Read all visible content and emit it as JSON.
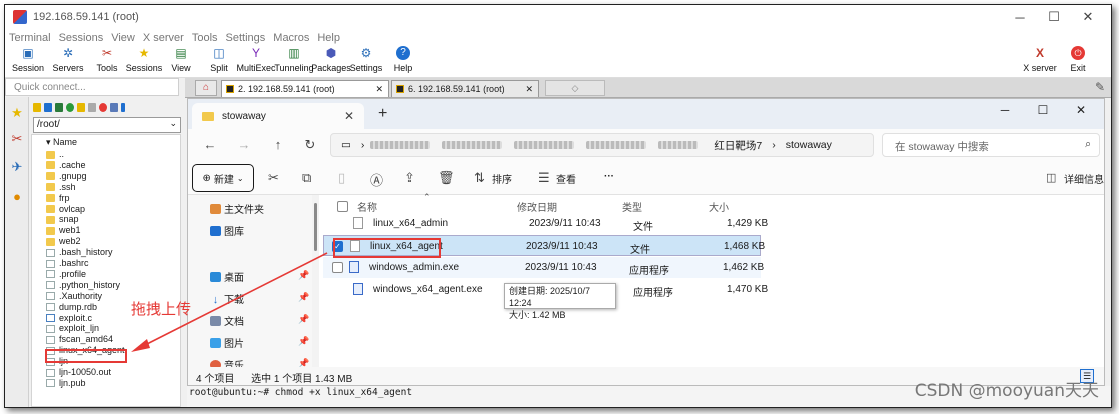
{
  "window": {
    "title": "192.168.59.141 (root)"
  },
  "menu": [
    "Terminal",
    "Sessions",
    "View",
    "X server",
    "Tools",
    "Settings",
    "Macros",
    "Help"
  ],
  "toolbar": {
    "items": [
      {
        "label": "Session",
        "icon": "session-icon"
      },
      {
        "label": "Servers",
        "icon": "servers-icon"
      },
      {
        "label": "Tools",
        "icon": "tools-icon"
      },
      {
        "label": "Sessions",
        "icon": "star-icon"
      },
      {
        "label": "View",
        "icon": "view-icon"
      },
      {
        "label": "Split",
        "icon": "split-icon"
      },
      {
        "label": "MultiExec",
        "icon": "multiexec-icon"
      },
      {
        "label": "Tunneling",
        "icon": "tunneling-icon"
      },
      {
        "label": "Packages",
        "icon": "packages-icon"
      },
      {
        "label": "Settings",
        "icon": "settings-icon"
      },
      {
        "label": "Help",
        "icon": "help-icon"
      }
    ],
    "xserver": "X server",
    "exit": "Exit"
  },
  "sidebar": {
    "quick_connect_placeholder": "Quick connect...",
    "path": "/root/",
    "header": "Name",
    "files": [
      {
        "name": "..",
        "type": "folder"
      },
      {
        "name": ".cache",
        "type": "folder"
      },
      {
        "name": ".gnupg",
        "type": "folder"
      },
      {
        "name": ".ssh",
        "type": "folder"
      },
      {
        "name": "frp",
        "type": "folder"
      },
      {
        "name": "ovlcap",
        "type": "folder"
      },
      {
        "name": "snap",
        "type": "folder"
      },
      {
        "name": "web1",
        "type": "folder"
      },
      {
        "name": "web2",
        "type": "folder"
      },
      {
        "name": ".bash_history",
        "type": "file"
      },
      {
        "name": ".bashrc",
        "type": "file"
      },
      {
        "name": ".profile",
        "type": "file"
      },
      {
        "name": ".python_history",
        "type": "file"
      },
      {
        "name": ".Xauthority",
        "type": "file"
      },
      {
        "name": "dump.rdb",
        "type": "file"
      },
      {
        "name": "exploit.c",
        "type": "cfile"
      },
      {
        "name": "exploit_ljn",
        "type": "file"
      },
      {
        "name": "fscan_amd64",
        "type": "file"
      },
      {
        "name": "linux_x64_agent",
        "type": "file"
      },
      {
        "name": "ljn",
        "type": "file"
      },
      {
        "name": "ljn-10050.out",
        "type": "file"
      },
      {
        "name": "ljn.pub",
        "type": "file"
      }
    ]
  },
  "session_tabs": [
    {
      "label": "2. 192.168.59.141 (root)",
      "active": true
    },
    {
      "label": "6. 192.168.59.141 (root)",
      "active": false
    }
  ],
  "explorer": {
    "tab_title": "stowaway",
    "breadcrumb": [
      "红日靶场7",
      "stowaway"
    ],
    "search_placeholder": "在 stowaway 中搜索",
    "commands": {
      "new": "新建",
      "sort": "排序",
      "view": "查看",
      "more": "···",
      "details": "详细信息"
    },
    "nav": [
      {
        "label": "主文件夹",
        "icon": "home-icon"
      },
      {
        "label": "图库",
        "icon": "gallery-icon"
      },
      {
        "label": "桌面",
        "icon": "desktop-icon"
      },
      {
        "label": "下载",
        "icon": "download-icon"
      },
      {
        "label": "文档",
        "icon": "documents-icon"
      },
      {
        "label": "图片",
        "icon": "pictures-icon"
      },
      {
        "label": "音乐",
        "icon": "music-icon"
      }
    ],
    "columns": {
      "name": "名称",
      "modified": "修改日期",
      "type": "类型",
      "size": "大小"
    },
    "files": [
      {
        "name": "linux_x64_admin",
        "modified": "2023/9/11 10:43",
        "type": "文件",
        "size": "1,429 KB",
        "selected": false
      },
      {
        "name": "linux_x64_agent",
        "modified": "2023/9/11 10:43",
        "type": "文件",
        "size": "1,468 KB",
        "selected": true
      },
      {
        "name": "windows_admin.exe",
        "modified": "2023/9/11 10:43",
        "type": "应用程序",
        "size": "1,462 KB",
        "selected": false
      },
      {
        "name": "windows_x64_agent.exe",
        "modified": "",
        "type": "应用程序",
        "size": "1,470 KB",
        "selected": false
      }
    ],
    "tooltip": {
      "created": "创建日期: 2025/10/7 12:24",
      "size": "大小: 1.42 MB"
    },
    "status": {
      "count": "4 个项目",
      "selection": "选中 1 个项目  1.43 MB"
    }
  },
  "terminal": {
    "line": "root@ubuntu:~# chmod +x linux_x64_agent"
  },
  "annotation": {
    "drag_label": "拖拽上传"
  },
  "watermark": "CSDN @mooyuan天天",
  "colors": {
    "highlight": "#e53935",
    "selection": "#cce4f7",
    "accent": "#1f6fcf"
  }
}
